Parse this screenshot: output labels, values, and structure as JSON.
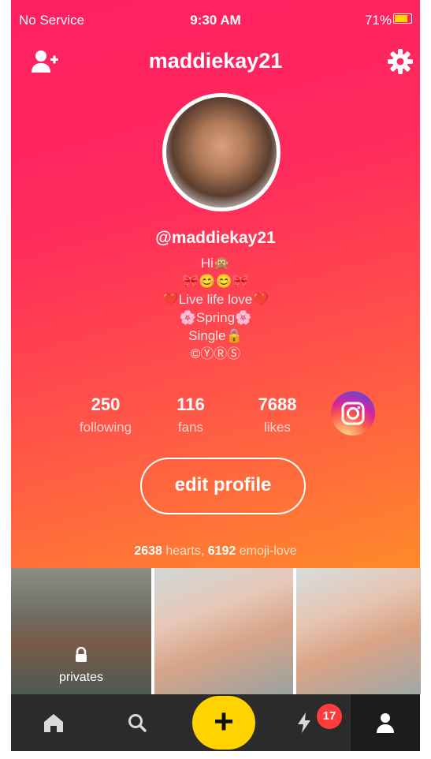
{
  "status_bar": {
    "carrier": "No Service",
    "time": "9:30 AM",
    "battery": "71%",
    "battery_level": 0.71
  },
  "header": {
    "title": "maddiekay21",
    "add_friend_icon": "person-plus-icon",
    "settings_icon": "gear-icon"
  },
  "profile": {
    "handle": "@maddiekay21",
    "bio_lines": [
      "Hi🙊",
      "🎀😊😊🎀",
      "❤️Live life love❤️",
      "🌸Spring🌸",
      "Single🔒",
      "©ⓎⓇⓈ"
    ]
  },
  "stats": [
    {
      "value": "250",
      "label": "following"
    },
    {
      "value": "116",
      "label": "fans"
    },
    {
      "value": "7688",
      "label": "likes"
    }
  ],
  "instagram_icon": "instagram-icon",
  "edit_button": "edit profile",
  "hearts": {
    "hearts_count": "2638",
    "hearts_label": "hearts,",
    "emoji_count": "6192",
    "emoji_label": "emoji-love"
  },
  "thumbnails": [
    {
      "label": "privates",
      "locked": true
    },
    {
      "label": ""
    },
    {
      "label": ""
    }
  ],
  "tabbar": {
    "home_icon": "home-icon",
    "search_icon": "search-icon",
    "add_label": "+",
    "activity_icon": "bolt-icon",
    "activity_badge": "17",
    "profile_icon": "person-icon"
  },
  "colors": {
    "gradient_top": "#ff1f63",
    "gradient_bottom": "#ff8a2a",
    "accent": "#ffd300",
    "tabbar": "#2c2b2c"
  }
}
